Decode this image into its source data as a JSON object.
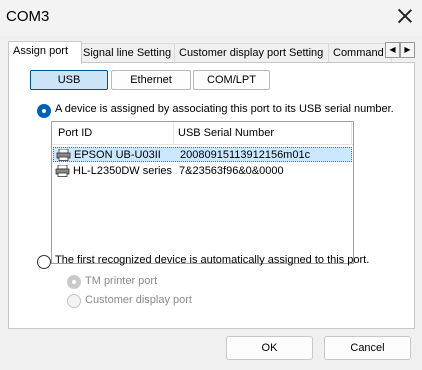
{
  "window": {
    "title": "COM3"
  },
  "tabs": [
    {
      "label": "Assign port"
    },
    {
      "label": "Signal line Setting"
    },
    {
      "label": "Customer display port Setting"
    },
    {
      "label": "Command ..."
    }
  ],
  "connection_types": [
    {
      "label": "USB",
      "selected": true
    },
    {
      "label": "Ethernet",
      "selected": false
    },
    {
      "label": "COM/LPT",
      "selected": false
    }
  ],
  "assign_by_serial": {
    "label": "A device is assigned by associating this port to its USB serial number.",
    "checked": true
  },
  "device_list": {
    "columns": [
      "Port ID",
      "USB Serial Number"
    ],
    "rows": [
      {
        "port_id": "EPSON UB-U03II",
        "serial": "20080915113912156m01c",
        "icon": "printer-icon",
        "selected": true
      },
      {
        "port_id": "HL-L2350DW series",
        "serial": "7&23563f96&0&0000",
        "icon": "printer-icon",
        "selected": false
      }
    ]
  },
  "auto_assign": {
    "label": "The first recognized device is automatically assigned to this port.",
    "checked": false
  },
  "auto_options": [
    {
      "label": "TM printer port",
      "checked": true,
      "enabled": false
    },
    {
      "label": "Customer display port",
      "checked": false,
      "enabled": false
    }
  ],
  "buttons": {
    "ok": "OK",
    "cancel": "Cancel"
  }
}
